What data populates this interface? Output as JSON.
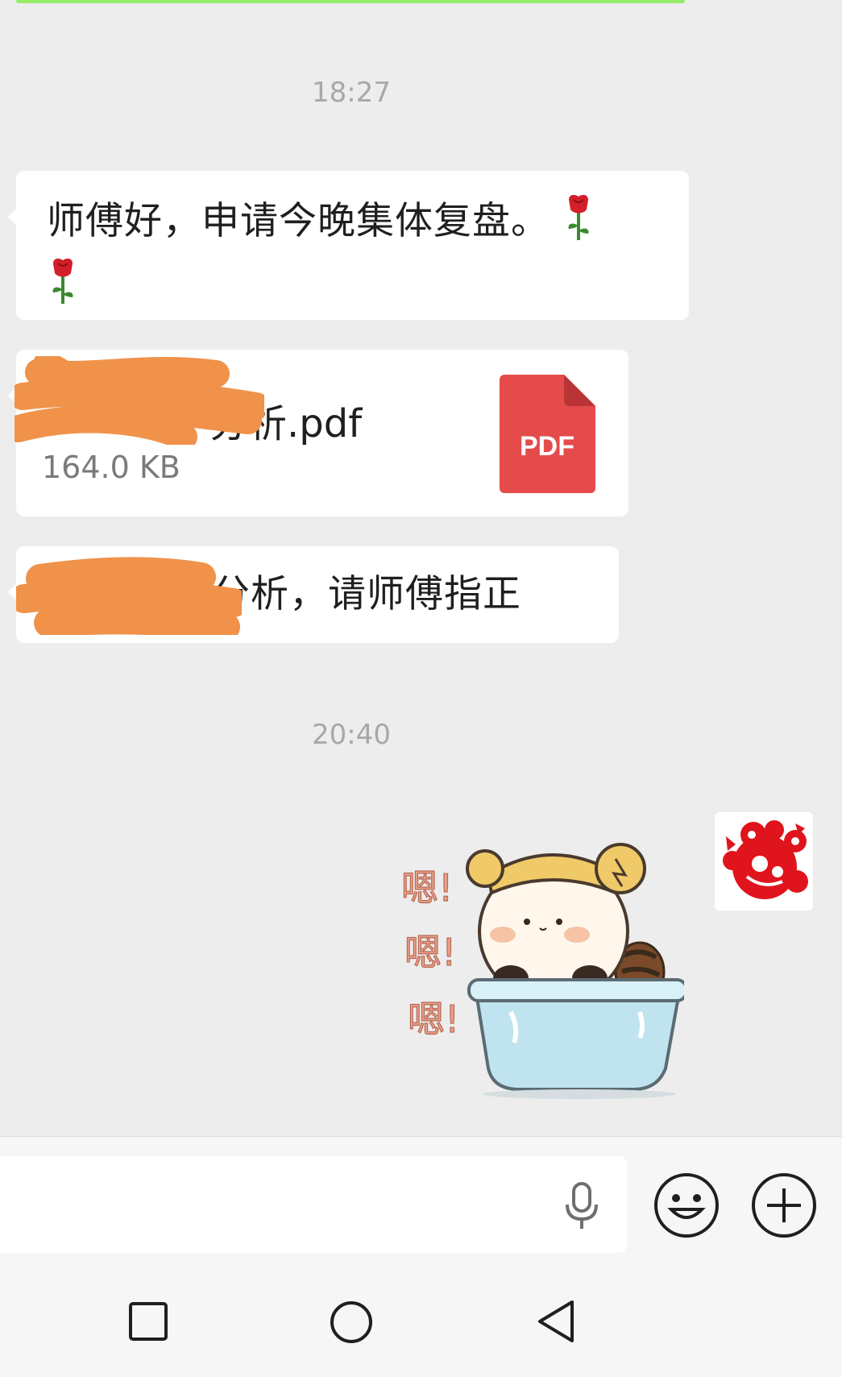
{
  "chat": {
    "timestamp_1": "18:27",
    "message_1": "师傅好，申请今晚集体复盘。",
    "file_message": {
      "name_visible": "分析.pdf",
      "size": "164.0 KB",
      "badge": "PDF"
    },
    "message_3_visible": "的分析，请师傅指正",
    "timestamp_2": "20:40",
    "sticker_text": [
      "嗯!",
      "嗯!",
      "嗯!"
    ]
  },
  "input_bar": {
    "placeholder": "",
    "icons": [
      "microphone-icon",
      "emoji-icon",
      "plus-icon"
    ]
  },
  "nav_bar": {
    "icons": [
      "recent-apps-icon",
      "home-icon",
      "back-icon"
    ]
  },
  "colors": {
    "background": "#ededed",
    "bubble": "#ffffff",
    "pdf_red": "#e54b4b",
    "redaction_orange": "#f0924a",
    "rose_red": "#d21f2a",
    "paper_cut_red": "#e0141c"
  }
}
